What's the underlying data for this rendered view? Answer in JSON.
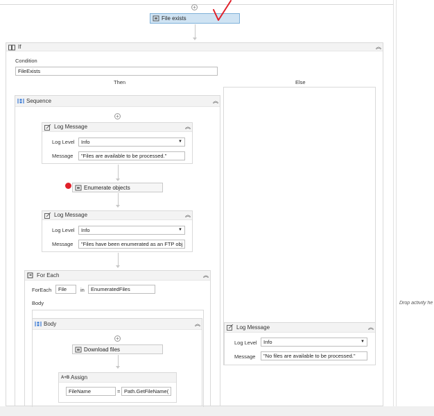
{
  "top_activity": {
    "label": "File exists"
  },
  "if_block": {
    "title": "If",
    "condition_label": "Condition",
    "condition_value": "FileExists",
    "then_label": "Then",
    "else_label": "Else"
  },
  "sequence": {
    "title": "Sequence"
  },
  "log1": {
    "title": "Log Message",
    "level_label": "Log Level",
    "level_value": "Info",
    "message_label": "Message",
    "message_value": "\"Files are available to be processed.\""
  },
  "enumerate": {
    "label": "Enumerate objects"
  },
  "log2": {
    "title": "Log Message",
    "level_label": "Log Level",
    "level_value": "Info",
    "message_label": "Message",
    "message_value": "\"Files have been enumerated as an FTP obj"
  },
  "foreach": {
    "title": "For Each",
    "foreach_label": "ForEach",
    "item_value": "File",
    "in_label": "in",
    "collection_value": "EnumeratedFiles",
    "body_label": "Body"
  },
  "body_seq": {
    "title": "Body"
  },
  "download": {
    "label": "Download files"
  },
  "assign": {
    "title": "Assign",
    "target_value": "FileName",
    "eq": "=",
    "expr_value": "Path.GetFileName("
  },
  "log3": {
    "title": "Log Message",
    "level_label": "Log Level",
    "level_value": "Info",
    "message_label": "Message",
    "message_value": "\"No files are available to be processed.\""
  },
  "drop_hint": "Drop activity he",
  "colors": {
    "selected_fill": "#cfe3f3",
    "selected_border": "#7fb1d9",
    "breakpoint": "#e0202a",
    "annotation": "#e0202a"
  }
}
